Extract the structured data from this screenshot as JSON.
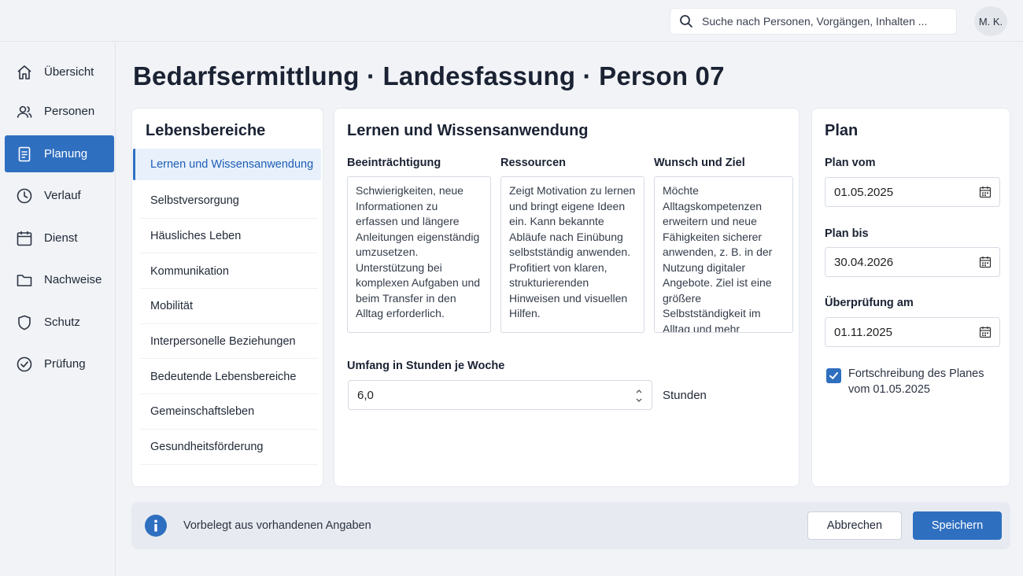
{
  "search": {
    "placeholder": "Suche nach Personen, Vorgängen, Inhalten ...",
    "icon": "search-icon"
  },
  "user": {
    "initials": "M. K."
  },
  "sidebar": {
    "items": [
      {
        "label": "Übersicht",
        "icon": "home-icon",
        "active": false
      },
      {
        "label": "Personen",
        "icon": "users-icon",
        "active": false
      },
      {
        "label": "Planung",
        "icon": "document-icon",
        "active": true
      },
      {
        "label": "Verlauf",
        "icon": "clock-icon",
        "active": false
      },
      {
        "label": "Dienst",
        "icon": "calendar-icon",
        "active": false
      },
      {
        "label": "Nachweise",
        "icon": "folder-icon",
        "active": false
      },
      {
        "label": "Schutz",
        "icon": "shield-icon",
        "active": false
      },
      {
        "label": "Prüfung",
        "icon": "check-circle-icon",
        "active": false
      }
    ]
  },
  "page": {
    "title": "Bedarfsermittlung · Landesfassung · Person 07"
  },
  "lebensbereiche": {
    "title": "Lebensbereiche",
    "items": [
      "Lernen und Wissensanwendung",
      "Selbstversorgung",
      "Häusliches Leben",
      "Kommunikation",
      "Mobilität",
      "Interpersonelle Beziehungen",
      "Bedeutende Lebensbereiche",
      "Gemeinschaftsleben",
      "Gesundheitsförderung"
    ],
    "active_index": 0
  },
  "detail": {
    "title": "Lernen und Wissensanwendung",
    "columns": [
      {
        "label": "Beeinträchtigung",
        "text": "Schwierigkeiten, neue Informationen zu erfassen und längere Anleitungen eigenständig umzusetzen. Unterstützung bei komplexen Aufgaben und beim Transfer in den Alltag erforderlich."
      },
      {
        "label": "Ressourcen",
        "text": "Zeigt Motivation zu lernen und bringt eigene Ideen ein. Kann bekannte Abläufe nach Einübung selbstständig anwenden. Profitiert von klaren, strukturierenden Hinweisen und visuellen Hilfen."
      },
      {
        "label": "Wunsch und Ziel",
        "text": "Möchte Alltagskompetenzen erweitern und neue Fähigkeiten sicherer anwenden, z. B. in der Nutzung digitaler Angebote. Ziel ist eine größere Selbstständigkeit im Alltag und mehr Sicherheit bei neuen Anforderungen."
      }
    ],
    "umfang": {
      "label": "Umfang in Stunden je Woche",
      "value": "6,0",
      "unit": "Stunden"
    }
  },
  "plan": {
    "title": "Plan",
    "plan_vom": {
      "label": "Plan vom",
      "value": "01.05.2025"
    },
    "plan_bis": {
      "label": "Plan bis",
      "value": "30.04.2026"
    },
    "ueberpruefung": {
      "label": "Überprüfung am",
      "value": "01.11.2025"
    },
    "fortschreibung": {
      "label": "Fortschreibung des Planes vom 01.05.2025",
      "checked": true
    }
  },
  "footer": {
    "note": "Vorbelegt aus vorhandenen Angaben",
    "cancel_label": "Abbrechen",
    "save_label": "Speichern"
  },
  "colors": {
    "accent": "#2f6fc0",
    "active_bg": "#e7f0fb",
    "page_bg": "#f1f3f6"
  }
}
